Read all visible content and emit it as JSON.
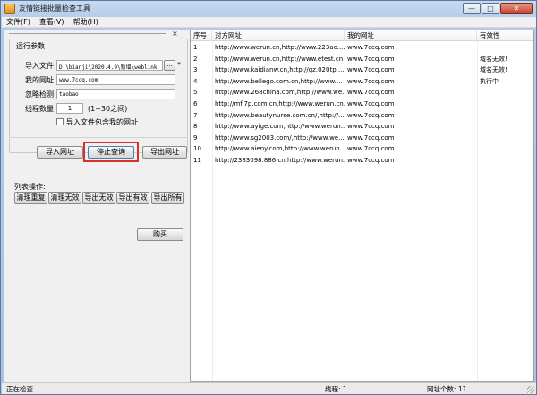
{
  "window": {
    "title": "友情链接批量检查工具"
  },
  "menu": [
    "文件(F)",
    "查看(V)",
    "帮助(H)"
  ],
  "params": {
    "group_title": "运行参数",
    "import_file_label": "导入文件:",
    "import_file_value": "D:\\bianji\\2020.4.9\\新增\\weblink",
    "browse_label": "...",
    "required_mark": "*",
    "my_url_label": "我的网址:",
    "my_url_value": "www.7ccq.com",
    "ignore_label": "忽略检测:",
    "ignore_value": "taobao",
    "threads_label": "线程数量:",
    "threads_value": "1",
    "threads_hint": "(1~30之间)",
    "include_my_url_label": "导入文件包含我的网址"
  },
  "actions": {
    "import": "导入网址",
    "stop": "停止查询",
    "export": "导出网址"
  },
  "list_ops": {
    "label": "列表操作:",
    "buttons": [
      "清理重复",
      "清理无效",
      "导出无效",
      "导出有效",
      "导出所有"
    ]
  },
  "buy": "购买",
  "table": {
    "headers": [
      "序号",
      "对方网址",
      "我的网址",
      "有效性"
    ],
    "rows": [
      [
        "1",
        "http://www.werun.cn,http://www.223ao....",
        "www.7ccq.com",
        ""
      ],
      [
        "2",
        "http://www.werun.cn,http://www.etest.cn",
        "www.7ccq.com",
        "域名无效!"
      ],
      [
        "3",
        "http://www.kaidianw.cn,http://gz.020tp....",
        "www.7ccq.com",
        "域名无效!"
      ],
      [
        "4",
        "http://www.bellego.com.cn,http://www....",
        "www.7ccq.com",
        "执行中"
      ],
      [
        "5",
        "http://www.268china.com,http://www.we...",
        "www.7ccq.com",
        ""
      ],
      [
        "6",
        "http://mf.7p.com.cn,http://www.werun.cn...",
        "www.7ccq.com",
        ""
      ],
      [
        "7",
        "http://www.beautynurse.com.cn/,http://...",
        "www.7ccq.com",
        ""
      ],
      [
        "8",
        "http://www.ayige.com,http://www.werun....",
        "www.7ccq.com",
        ""
      ],
      [
        "9",
        "http://www.sg2003.com/,http://www.we...",
        "www.7ccq.com",
        ""
      ],
      [
        "10",
        "http://www.aieny.com,http://www.werun....",
        "www.7ccq.com",
        ""
      ],
      [
        "11",
        "http://2383098.886.cn,http://www.werun....",
        "www.7ccq.com",
        ""
      ]
    ]
  },
  "status": {
    "left": "正在检查...",
    "threads": "线程: 1",
    "url_count": "网址个数: 11"
  }
}
